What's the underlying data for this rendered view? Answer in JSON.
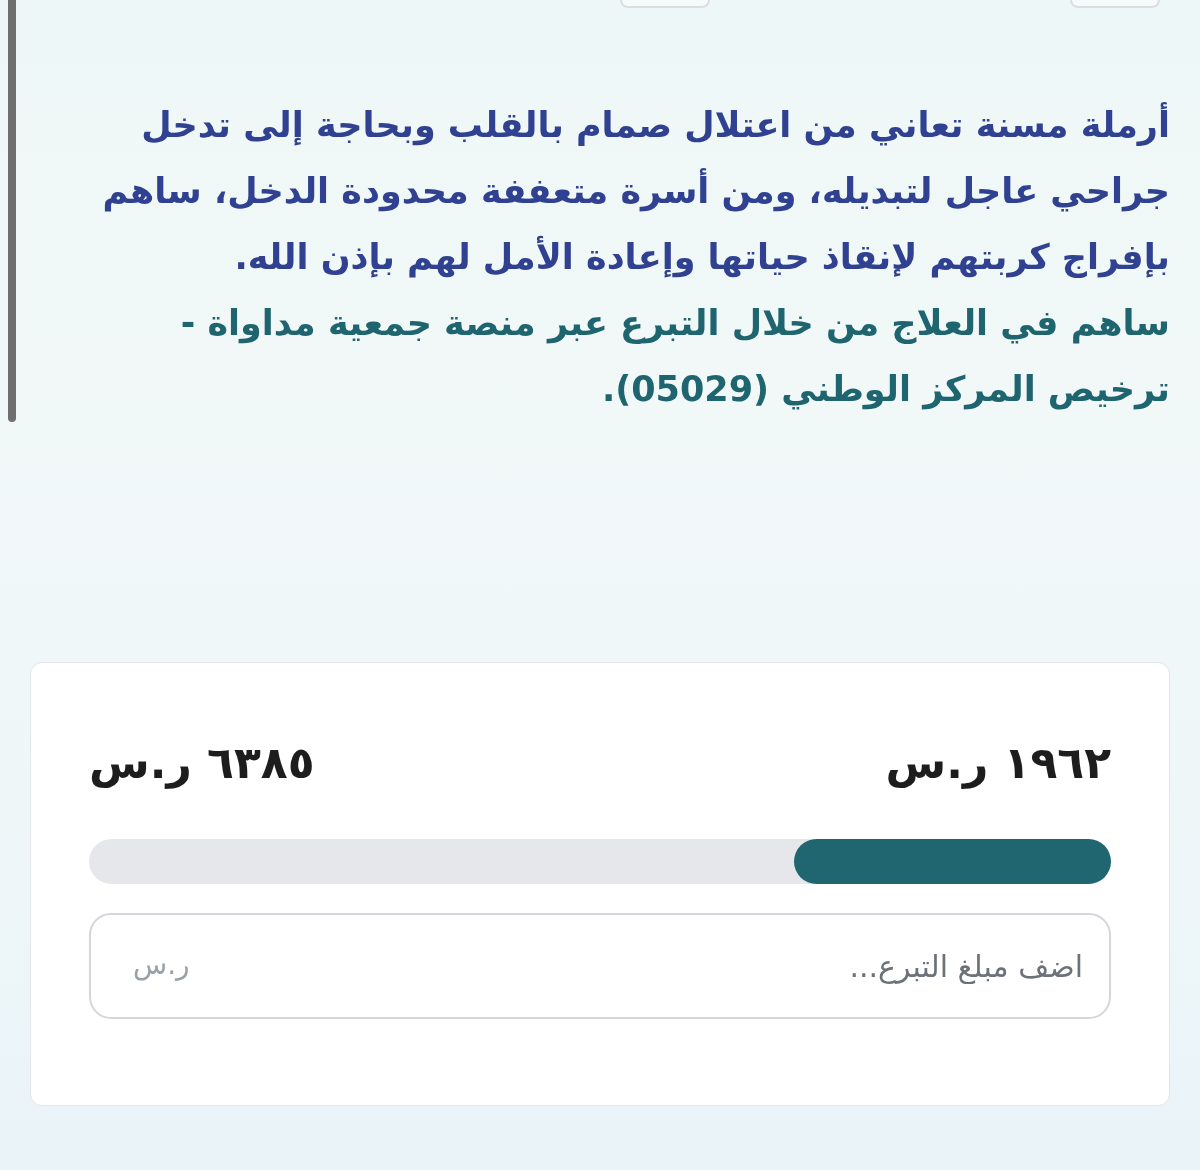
{
  "description": {
    "paragraphs": [
      {
        "kind": "appeal",
        "text": "أرملة مسنة تعاني من اعتلال صمام بالقلب وبحاجة إلى تدخل جراحي عاجل لتبديله، ومن أسرة متعففة محدودة الدخل، ساهم بإفراج كربتهم لإنقاذ حياتها وإعادة الأمل لهم بإذن الله."
      },
      {
        "kind": "license",
        "text": "ساهم في العلاج من خلال التبرع عبر منصة جمعية مداواة - ترخيص المركز الوطني (05029)."
      }
    ]
  },
  "donation_card": {
    "raised": "١٩٦٢ ر.س",
    "goal": "٦٣٨٥ ر.س",
    "progress": {
      "level": 0.31
    },
    "amount_field": {
      "placeholder": "اضف مبلغ التبرع...",
      "currency": "ر.س"
    }
  }
}
